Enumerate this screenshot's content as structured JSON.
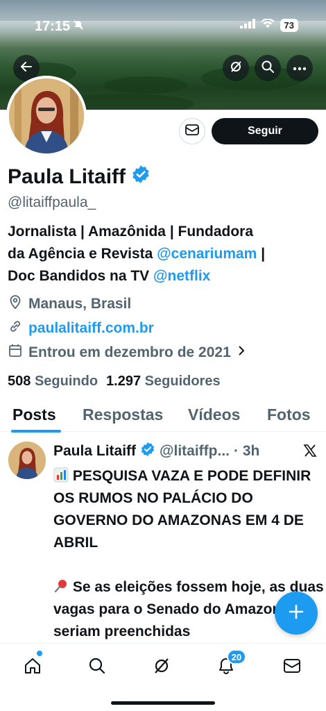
{
  "status_bar": {
    "time": "17:15",
    "battery": "73"
  },
  "profile": {
    "name": "Paula Litaiff",
    "handle": "@litaiffpaula_",
    "bio_line1": "Jornalista | Amazônida | Fundadora",
    "bio_line2_prefix": "da Agência e Revista ",
    "bio_link1": "@cenariumam",
    "bio_line2_suffix": " |",
    "bio_line3_prefix": "Doc Bandidos na TV ",
    "bio_link2": "@netflix",
    "location": "Manaus, Brasil",
    "website": "paulalitaiff.com.br",
    "joined": "Entrou em dezembro de 2021",
    "following_count": "508",
    "following_label": "Seguindo",
    "followers_count": "1.297",
    "followers_label": "Seguidores"
  },
  "actions": {
    "follow_label": "Seguir"
  },
  "tabs": [
    {
      "label": "Posts"
    },
    {
      "label": "Respostas"
    },
    {
      "label": "Vídeos"
    },
    {
      "label": "Fotos"
    }
  ],
  "tweet": {
    "name": "Paula Litaiff",
    "handle": "@litaiffp...",
    "time": "· 3h",
    "para1": "PESQUISA VAZA E PODE DEFINIR OS RUMOS NO PALÁCIO DO GOVERNO DO AMAZONAS EM 4 DE ABRIL",
    "para2": "Se as eleições fossem hoje, as duas vagas para o Senado do Amazonas seriam preenchidas"
  },
  "bottom_nav": {
    "notifications_badge": "20"
  },
  "icons": [
    "back-arrow-icon",
    "grok-icon",
    "search-icon",
    "more-icon",
    "message-icon",
    "verified-badge-icon",
    "location-pin-icon",
    "link-icon",
    "calendar-icon",
    "chevron-right-icon",
    "chart-emoji-icon",
    "pushpin-emoji-icon",
    "x-logo-icon",
    "plus-icon",
    "home-icon",
    "notifications-icon"
  ],
  "colors": {
    "accent": "#1d9bf0",
    "text": "#0f1419",
    "secondary": "#536471"
  }
}
